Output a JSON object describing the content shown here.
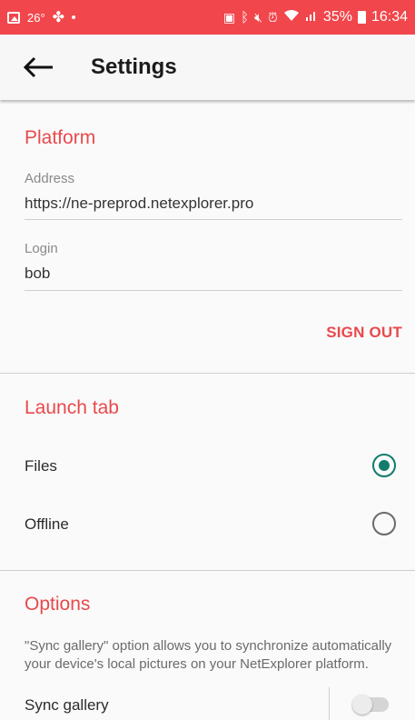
{
  "status_bar": {
    "temperature": "26°",
    "battery_percent": "35%",
    "time": "16:34",
    "left_icons": [
      "gallery-icon",
      "fan-icon",
      "dot-icon"
    ],
    "right_icons": [
      "battery-saver-icon",
      "bluetooth-icon",
      "mute-icon",
      "alarm-icon",
      "wifi-icon",
      "signal-icon",
      "battery-icon"
    ]
  },
  "app_bar": {
    "title": "Settings",
    "back_icon": "arrow-left-icon"
  },
  "platform": {
    "section_title": "Platform",
    "address_label": "Address",
    "address_value": "https://ne-preprod.netexplorer.pro",
    "login_label": "Login",
    "login_value": "bob",
    "sign_out_label": "SIGN OUT"
  },
  "launch_tab": {
    "section_title": "Launch tab",
    "options": [
      {
        "label": "Files",
        "selected": true
      },
      {
        "label": "Offline",
        "selected": false
      }
    ]
  },
  "options": {
    "section_title": "Options",
    "description": "\"Sync gallery\" option allows you to synchronize automatically your device's local pictures on your NetExplorer platform.",
    "sync_gallery_label": "Sync gallery",
    "sync_gallery_enabled": false
  },
  "colors": {
    "status_bar": "#f1464b",
    "accent": "#e8494c",
    "radio_checked": "#117c6b"
  }
}
